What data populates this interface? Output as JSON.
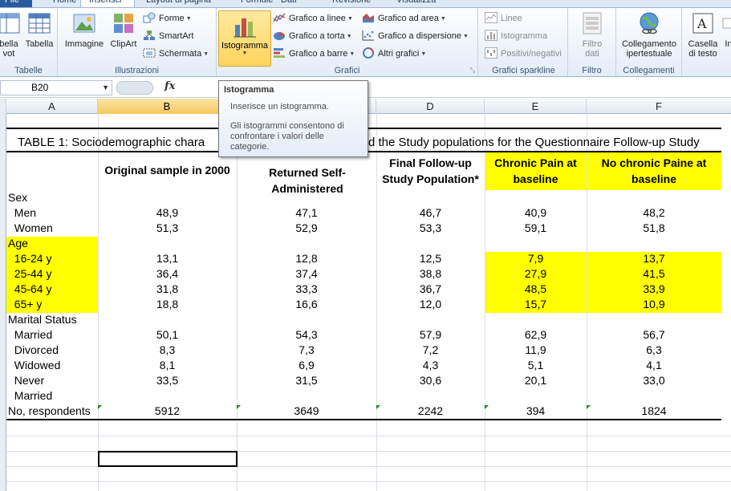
{
  "tabs": [
    "File",
    "Home",
    "Inserisci",
    "Layout di pagina",
    "Formule",
    "Dati",
    "Revisione",
    "Visualizza"
  ],
  "ribbon": {
    "tabelle": {
      "label": "Tabelle",
      "pivot_label": "bella\nvot",
      "tabella_label": "Tabella"
    },
    "illustrazioni": {
      "label": "Illustrazioni",
      "immagine": "Immagine",
      "clipart": "ClipArt",
      "forme": "Forme",
      "smartart": "SmartArt",
      "schermata": "Schermata"
    },
    "grafici": {
      "label": "Grafici",
      "istogramma": "Istogramma",
      "linee": "Grafico a linee",
      "torta": "Grafico a torta",
      "barre": "Grafico a barre",
      "area": "Grafico ad area",
      "dispersione": "Grafico a dispersione",
      "altri": "Altri grafici"
    },
    "sparkline": {
      "label": "Grafici sparkline",
      "linee": "Linee",
      "istogramma": "Istogramma",
      "positivi": "Positivi/negativi"
    },
    "filtro": {
      "label": "Filtro",
      "filtro_dati": "Filtro dati"
    },
    "collegamenti": {
      "label": "Collegamenti",
      "collegamento": "Collegamento ipertestuale"
    },
    "testo": {
      "casella": "Casella di testo",
      "intestaz": "In"
    }
  },
  "formula_bar": {
    "name_box": "B20",
    "fx": "fx",
    "value": ""
  },
  "columns": [
    "A",
    "B",
    "C",
    "D",
    "E",
    "F"
  ],
  "tooltip": {
    "title": "Istogramma",
    "line1": "Inserisce un istogramma.",
    "line2": "Gli istogrammi consentono di confrontare i valori delle categorie."
  },
  "table": {
    "title_left": "TABLE 1: Sociodemographic chara",
    "title_right": "d the Study populations for the Questionnaire Follow-up Study",
    "col_headers": [
      "Original sample in 2000",
      "Returned Self-Administered",
      "Final Follow-up Study Population*",
      "Chronic Pain  at baseline",
      "No chronic Paine at baseline"
    ],
    "rows": [
      {
        "label": "Sex",
        "values": [
          "",
          "",
          "",
          "",
          ""
        ]
      },
      {
        "label": "  Men",
        "values": [
          "48,9",
          "47,1",
          "46,7",
          "40,9",
          "48,2"
        ]
      },
      {
        "label": "  Women",
        "values": [
          "51,3",
          "52,9",
          "53,3",
          "59,1",
          "51,8"
        ]
      },
      {
        "label": "Age",
        "values": [
          "",
          "",
          "",
          "",
          ""
        ]
      },
      {
        "label": "  16-24 y",
        "values": [
          "13,1",
          "12,8",
          "12,5",
          "7,9",
          "13,7"
        ]
      },
      {
        "label": "  25-44 y",
        "values": [
          "36,4",
          "37,4",
          "38,8",
          "27,9",
          "41,5"
        ]
      },
      {
        "label": "  45-64 y",
        "values": [
          "31,8",
          "33,3",
          "36,7",
          "48,5",
          "33,9"
        ]
      },
      {
        "label": "  65+ y",
        "values": [
          "18,8",
          "16,6",
          "12,0",
          "15,7",
          "10,9"
        ]
      },
      {
        "label": "Marital Status",
        "values": [
          "",
          "",
          "",
          "",
          ""
        ]
      },
      {
        "label": "  Married",
        "values": [
          "50,1",
          "54,3",
          "57,9",
          "62,9",
          "56,7"
        ]
      },
      {
        "label": "  Divorced",
        "values": [
          "8,3",
          "7,3",
          "7,2",
          "11,9",
          "6,3"
        ]
      },
      {
        "label": "  Widowed",
        "values": [
          "8,1",
          "6,9",
          "4,3",
          "5,1",
          "4,1"
        ]
      },
      {
        "label": "  Never",
        "values": [
          "33,5",
          "31,5",
          "30,6",
          "20,1",
          "33,0"
        ]
      },
      {
        "label": "  Married",
        "values": [
          "",
          "",
          "",
          "",
          ""
        ]
      },
      {
        "label": "No, respondents",
        "values": [
          "5912",
          "3649",
          "2242",
          "394",
          "1824"
        ]
      }
    ]
  },
  "colors": {
    "highlight": "#ffff00",
    "ribbon_active": "#ffd45e",
    "tab_file": "#2a5a9e"
  }
}
